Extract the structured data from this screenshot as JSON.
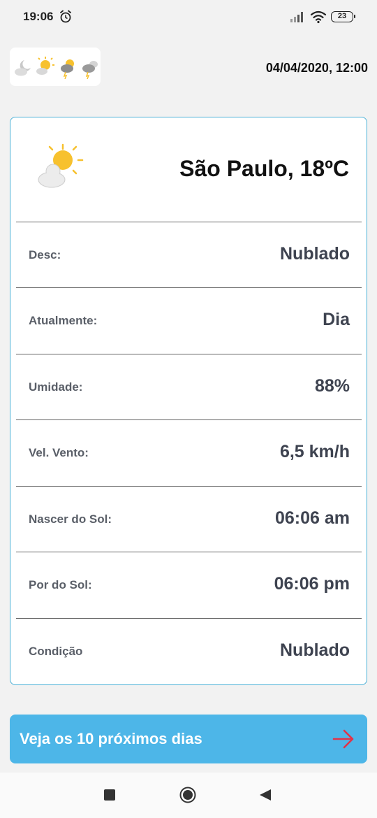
{
  "status_bar": {
    "time": "19:06",
    "battery": "23"
  },
  "header": {
    "datetime": "04/04/2020, 12:00"
  },
  "weather": {
    "city_temp": "São Paulo, 18ºC",
    "rows": [
      {
        "label": "Desc:",
        "value": "Nublado"
      },
      {
        "label": "Atualmente:",
        "value": "Dia"
      },
      {
        "label": "Umidade:",
        "value": "88%"
      },
      {
        "label": "Vel. Vento:",
        "value": "6,5 km/h"
      },
      {
        "label": "Nascer do Sol:",
        "value": "06:06 am"
      },
      {
        "label": "Por do Sol:",
        "value": "06:06 pm"
      },
      {
        "label": "Condição",
        "value": "Nublado"
      }
    ]
  },
  "cta": {
    "label": "Veja os 10 próximos dias"
  },
  "colors": {
    "accent": "#4db6e8",
    "card_border": "#4ab0d6",
    "arrow": "#e0344a",
    "sun": "#f7c12e"
  },
  "icons": {
    "alarm": "alarm-icon",
    "signal": "signal-icon",
    "wifi": "wifi-icon",
    "weather": "partly-cloudy-icon",
    "arrow": "arrow-right-icon",
    "nav": [
      "recents-icon",
      "home-icon",
      "back-icon"
    ]
  }
}
